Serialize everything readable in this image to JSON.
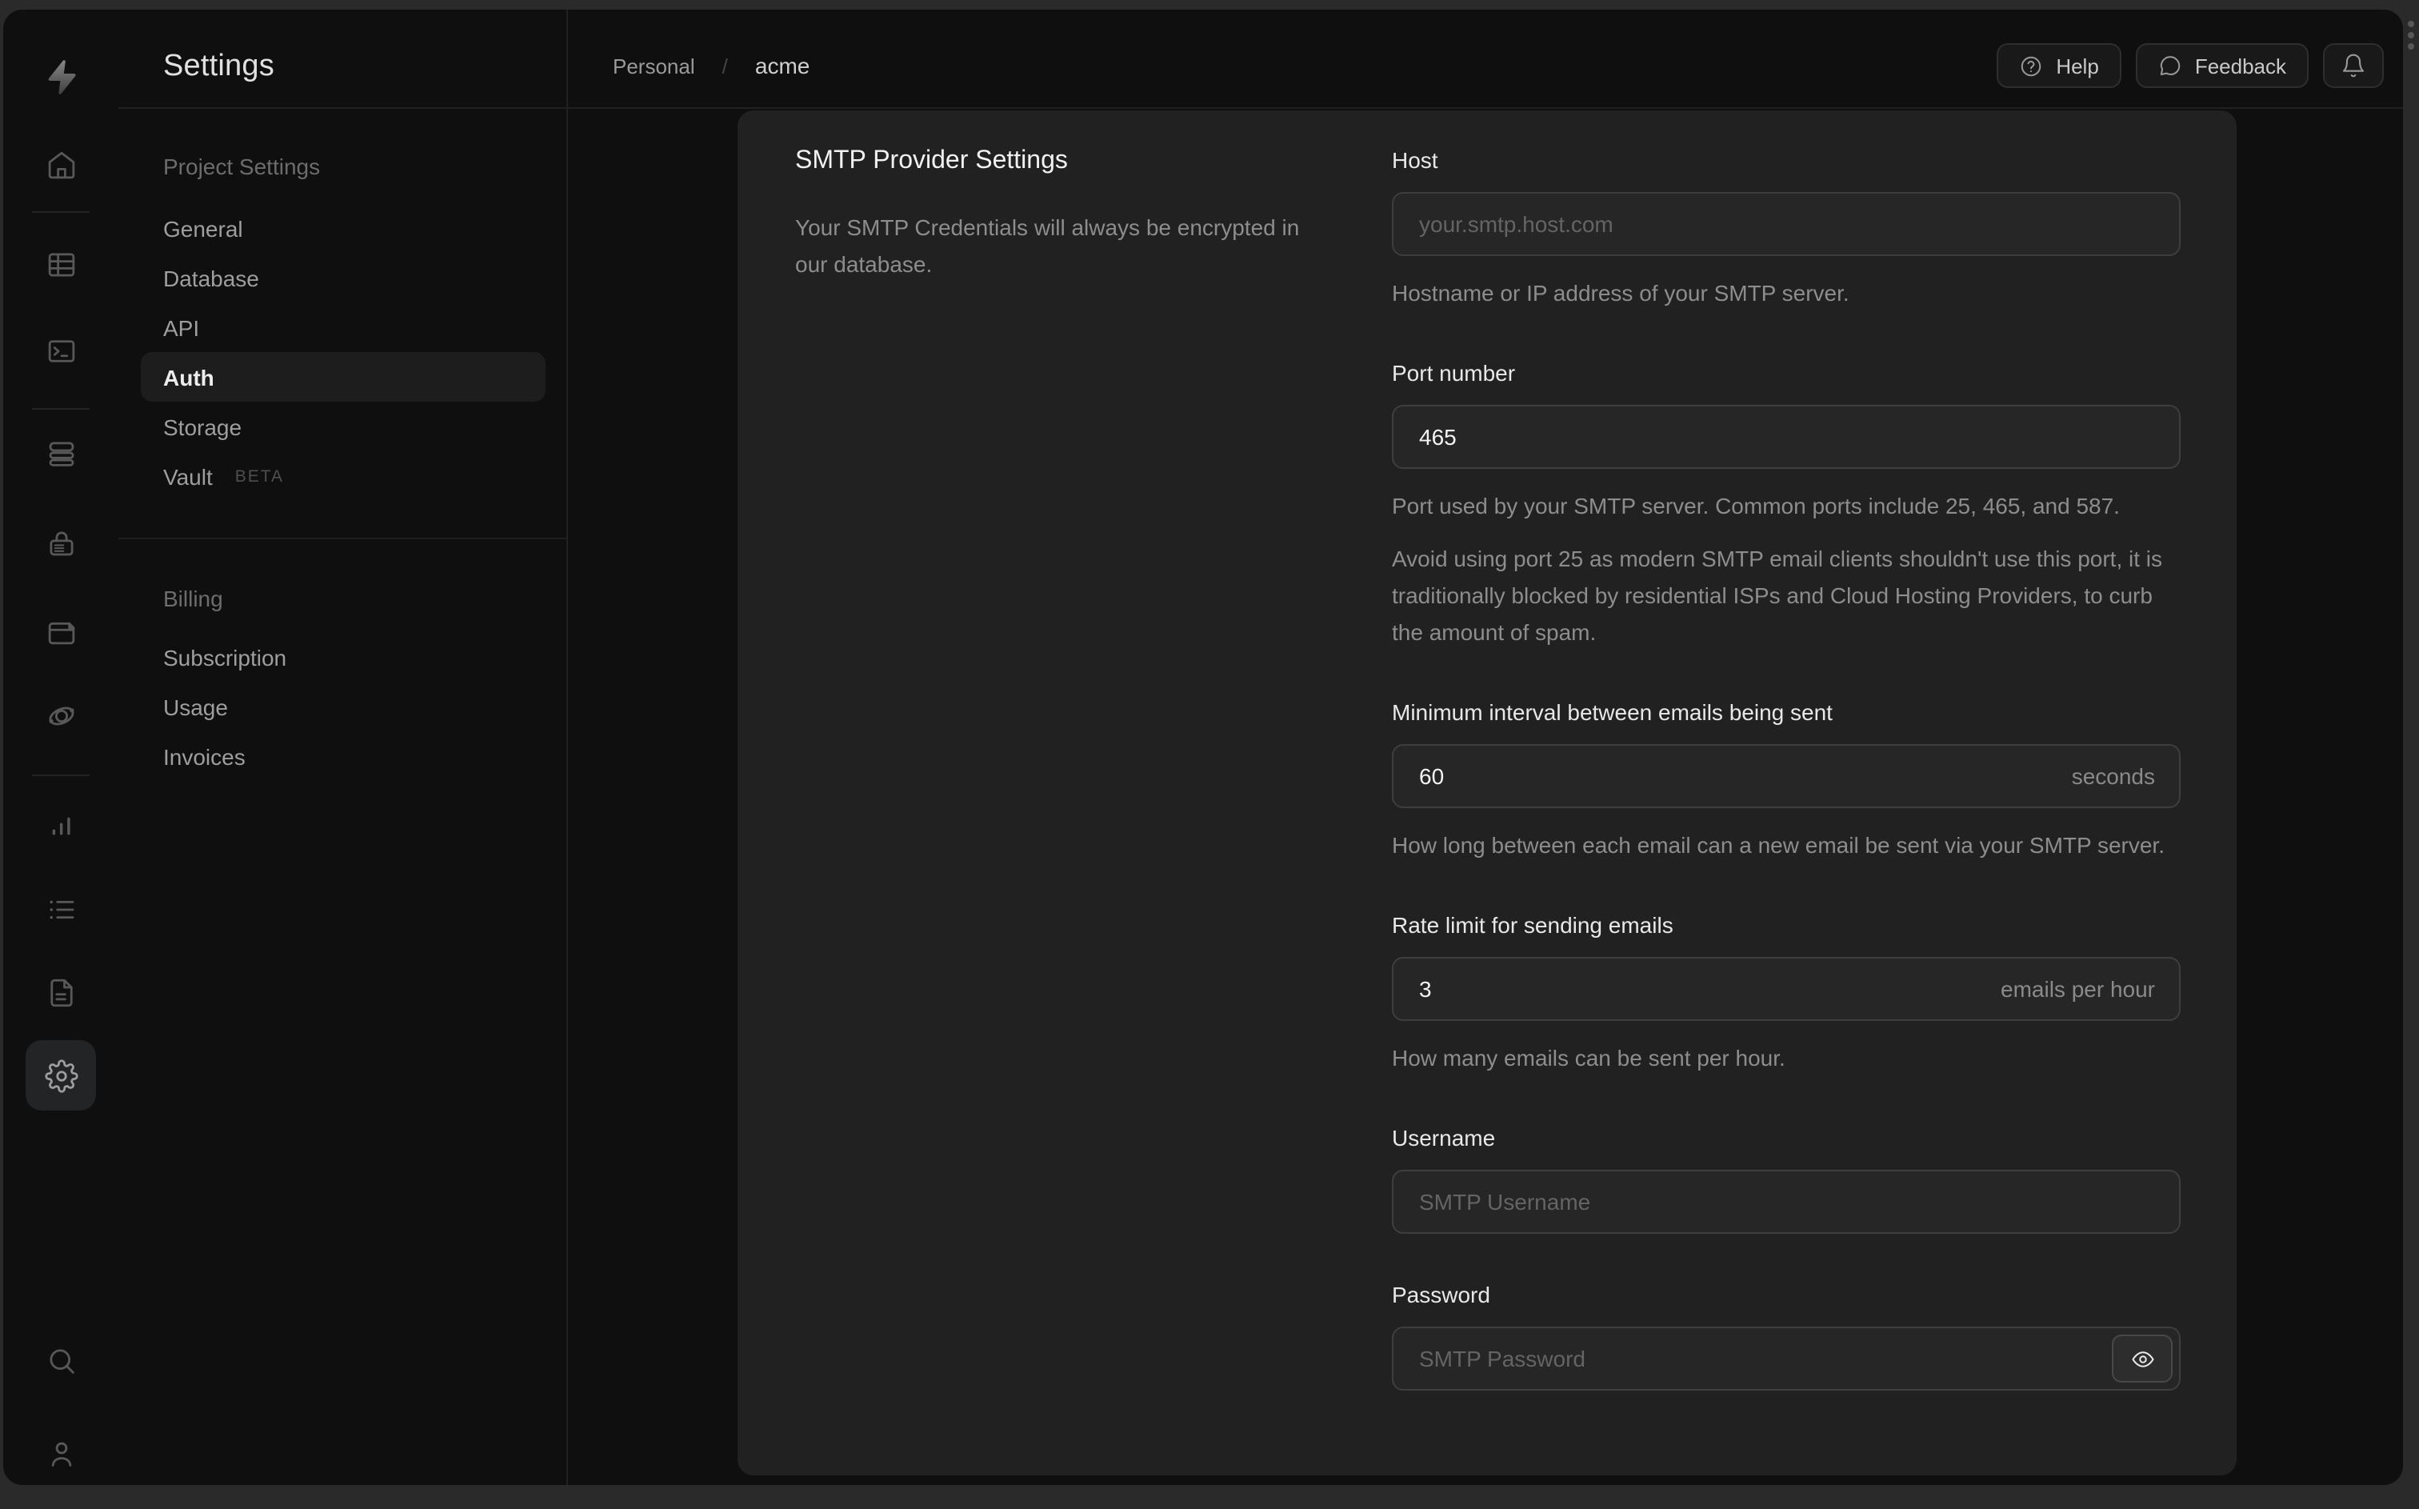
{
  "sidebar": {
    "title": "Settings",
    "sections": [
      {
        "label": "Project Settings",
        "items": [
          {
            "label": "General"
          },
          {
            "label": "Database"
          },
          {
            "label": "API"
          },
          {
            "label": "Auth",
            "active": true
          },
          {
            "label": "Storage"
          },
          {
            "label": "Vault",
            "badge": "BETA"
          }
        ]
      },
      {
        "label": "Billing",
        "items": [
          {
            "label": "Subscription"
          },
          {
            "label": "Usage"
          },
          {
            "label": "Invoices"
          }
        ]
      }
    ]
  },
  "rail": {
    "icons": [
      "supabase-logo",
      "home",
      "table-editor",
      "sql-editor",
      "database",
      "auth",
      "storage",
      "edge-functions",
      "reports",
      "logs",
      "docs",
      "settings",
      "search",
      "user"
    ],
    "active": "settings"
  },
  "topbar": {
    "breadcrumb": {
      "org": "Personal",
      "separator": "/",
      "project": "acme"
    },
    "help_label": "Help",
    "feedback_label": "Feedback"
  },
  "main": {
    "section_title": "SMTP Provider Settings",
    "section_description": "Your SMTP Credentials will always be encrypted in our database.",
    "fields": {
      "host": {
        "label": "Host",
        "placeholder": "your.smtp.host.com",
        "help": "Hostname or IP address of your SMTP server."
      },
      "port": {
        "label": "Port number",
        "value": "465",
        "help": "Port used by your SMTP server. Common ports include 25, 465, and 587.",
        "help2": "Avoid using port 25 as modern SMTP email clients shouldn't use this port, it is traditionally blocked by residential ISPs and Cloud Hosting Providers, to curb the amount of spam."
      },
      "interval": {
        "label": "Minimum interval between emails being sent",
        "value": "60",
        "suffix": "seconds",
        "help": "How long between each email can a new email be sent via your SMTP server."
      },
      "rate": {
        "label": "Rate limit for sending emails",
        "value": "3",
        "suffix": "emails per hour",
        "help": "How many emails can be sent per hour."
      },
      "username": {
        "label": "Username",
        "placeholder": "SMTP Username"
      },
      "password": {
        "label": "Password",
        "placeholder": "SMTP Password"
      }
    }
  },
  "colors": {
    "backdrop": "#2a2a2a",
    "window_bg": "#0f0f0f",
    "card_bg": "#212121",
    "input_bg": "#262626",
    "input_border": "#3e3e3e",
    "divider": "#212121",
    "text_primary": "#ededed",
    "text_muted": "#8d8d8d"
  }
}
